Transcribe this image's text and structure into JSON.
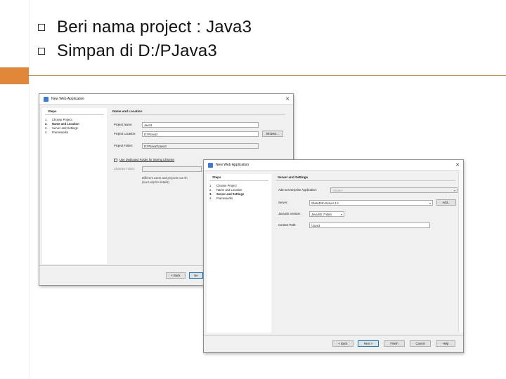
{
  "slide": {
    "bullets": [
      {
        "text": "Beri nama project : Java3"
      },
      {
        "text": "Simpan di D:/PJava3"
      }
    ],
    "accent_color": "#e0873a"
  },
  "dialog_back": {
    "title": "New Web Application",
    "steps_heading": "Steps",
    "steps": [
      {
        "n": "1.",
        "label": "Choose Project"
      },
      {
        "n": "2.",
        "label": "Name and Location"
      },
      {
        "n": "3.",
        "label": "Server and Settings"
      },
      {
        "n": "4.",
        "label": "Frameworks"
      }
    ],
    "panel_heading": "Name and Location",
    "project_name_label": "Project Name:",
    "project_name_value": "Java3",
    "project_location_label": "Project Location:",
    "project_location_value": "D:\\PJava3",
    "browse_label": "Browse...",
    "project_folder_label": "Project Folder:",
    "project_folder_value": "D:\\PJava3\\Java3",
    "dedicated_folder_label": "Use Dedicated Folder for Storing Libraries",
    "libraries_folder_label": "Libraries Folder:",
    "note_line1": "Different users and projects can sh",
    "note_line2": "(see Help for details).",
    "back_label": "< Back",
    "next_label": "Ne"
  },
  "dialog_front": {
    "title": "New Web Application",
    "steps_heading": "Steps",
    "steps": [
      {
        "n": "1.",
        "label": "Choose Project"
      },
      {
        "n": "2.",
        "label": "Name and Location"
      },
      {
        "n": "3.",
        "label": "Server and Settings"
      },
      {
        "n": "4.",
        "label": "Frameworks"
      }
    ],
    "panel_heading": "Server and Settings",
    "add_to_ear_label": "Add to Enterprise Application:",
    "add_to_ear_value": "<None>",
    "server_label": "Server:",
    "server_value": "GlassFish Server 4.1",
    "add_label": "Add...",
    "java_ee_label": "Java EE Version:",
    "java_ee_value": "Java EE 7 Web",
    "context_path_label": "Context Path:",
    "context_path_value": "/Java3",
    "back_label": "< Back",
    "next_label": "Next >",
    "finish_label": "Finish",
    "cancel_label": "Cancel",
    "help_label": "Help"
  }
}
